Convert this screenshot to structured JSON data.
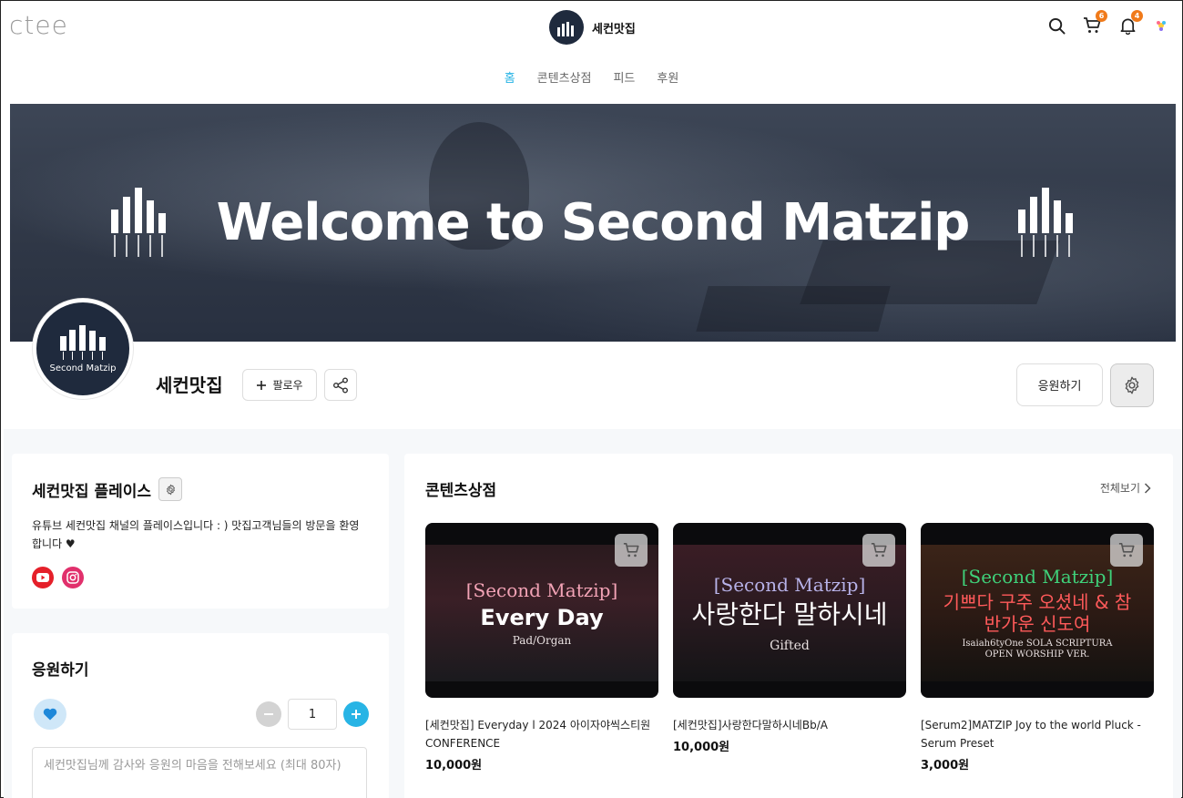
{
  "header": {
    "logo": "ctee",
    "brand_name": "세컨맛집",
    "brand_avatar_label": "Second Matzip",
    "cart_badge": "6",
    "notification_badge": "4",
    "icons": [
      "search-icon",
      "cart-icon",
      "bell-icon",
      "profile-icon"
    ]
  },
  "nav": {
    "tabs": [
      {
        "label": "홈",
        "active": true
      },
      {
        "label": "콘텐츠상점",
        "active": false
      },
      {
        "label": "피드",
        "active": false
      },
      {
        "label": "후원",
        "active": false
      }
    ]
  },
  "banner": {
    "title": "Welcome to Second Matzip"
  },
  "channel": {
    "avatar_label": "Second Matzip",
    "name": "세컨맛집",
    "follow_label": "팔로우",
    "support_label": "응원하기"
  },
  "place": {
    "title": "세컨맛집 플레이스",
    "description": "유튜브 세컨맛집 채널의 플레이스입니다 : ) 맛집고객님들의 방문을 환영합니다 ♥",
    "sns": [
      "youtube-icon",
      "instagram-icon"
    ]
  },
  "support": {
    "title": "응원하기",
    "quantity": "1",
    "message_placeholder": "세컨맛집님께 감사와 응원의 마음을 전해보세요 (최대 80자)"
  },
  "store": {
    "title": "콘텐츠상점",
    "see_all": "전체보기",
    "products": [
      {
        "thumb_bracket": "[Second Matzip]",
        "thumb_main": "Every Day",
        "thumb_sub": "Pad/Organ",
        "bracket_color": "#f3a3b6",
        "name": "[세컨맛집] Everyday l 2024 아이자야씩스티원 CONFERENCE",
        "price": "10,000원"
      },
      {
        "thumb_bracket": "[Second Matzip]",
        "thumb_main": "사랑한다 말하시네",
        "thumb_sub": "Gifted",
        "bracket_color": "#b7b2e8",
        "name": "[세컨맛집]사랑한다말하시네Bb/A",
        "price": "10,000원"
      },
      {
        "thumb_bracket": "[Second Matzip]",
        "thumb_main": "기쁘다 구주 오셨네 & 참 반가운 신도여",
        "thumb_sub": "Isaiah6tyOne SOLA SCRIPTURA OPEN WORSHIP VER.",
        "bracket_color": "#3fd17a",
        "name": "[Serum2]MATZIP Joy to the world Pluck - Serum Preset",
        "price": "3,000원"
      }
    ]
  },
  "colors": {
    "accent": "#28b4e5",
    "badge": "#f07a1a",
    "avatar_bg": "#1f2a3d"
  }
}
